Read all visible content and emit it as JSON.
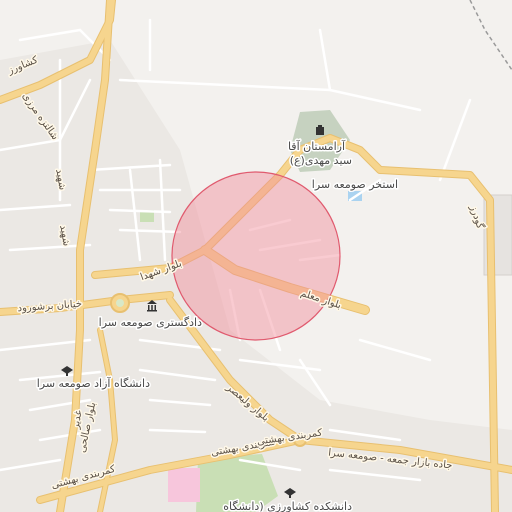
{
  "map": {
    "labels": {
      "cemetery": "آرامستان آقا",
      "cemetery2": "سید مهدی(ع)",
      "pool": "استخر صومعه سرا",
      "courthouse": "دادگستری صومعه سرا",
      "azad_university": "دانشگاه آزاد صومعه سرا",
      "agri_college": "دانشکده کشاورزی (دانشگاه",
      "blvd_shohada": "بلوار شهدا",
      "blvd_moallem": "بلوار معلم",
      "kh_borshorud": "خیابان برشورود",
      "blvd_valiasr": "بلوار ولیعصر",
      "blvd_salehi": "بلوار صالحی",
      "ring_beheshti": "کمربندی بهشتی",
      "ring_beheshti2": "کمربندی بهشتی",
      "ring_beheshti3": "کمربندی بهشتی",
      "road_bazar": "جاده بازار جمعه - صومعه سرا",
      "kh_keshavarz": "کشاورز",
      "kh_shahid_m": "شهید",
      "kh_shahid_v": "شهید",
      "kh_shaltezar": "شالتزه مرزی",
      "kh_gudarz": "گودرز",
      "kh_ghadir": "غدیر"
    },
    "colors": {
      "background": "#f3f1ee",
      "road_major": "#f6d58e",
      "road_major_casing": "#e8c070",
      "road_minor": "#ffffff",
      "park": "#c9dfb5",
      "cemetery": "#c6d2c0",
      "circle_fill": "#f28b9a",
      "circle_stroke": "#e05a6e",
      "pink_area": "#f7c6dc",
      "water": "#aad3f0"
    },
    "icons": [
      "monument-icon",
      "courthouse-icon",
      "university-icon",
      "university-icon"
    ]
  }
}
